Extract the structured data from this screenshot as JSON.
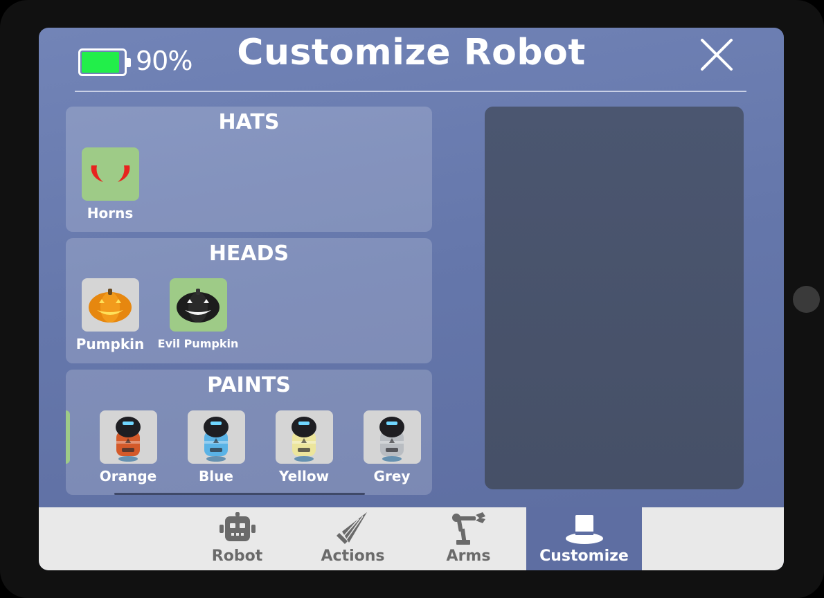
{
  "header": {
    "battery_percent": "90%",
    "battery_level": 0.9,
    "title": "Customize Robot"
  },
  "sections": {
    "hats": {
      "title": "HATS",
      "items": [
        {
          "label": "Horns",
          "icon": "horns-icon",
          "selected": true
        }
      ]
    },
    "heads": {
      "title": "HEADS",
      "items": [
        {
          "label": "Pumpkin",
          "icon": "pumpkin-icon",
          "selected": false
        },
        {
          "label": "Evil Pumpkin",
          "icon": "evil-pumpkin-icon",
          "selected": true
        }
      ]
    },
    "paints": {
      "title": "PAINTS",
      "items": [
        {
          "label": "Orange",
          "icon": "robot-orange-icon",
          "color": "#d45a2a"
        },
        {
          "label": "Blue",
          "icon": "robot-blue-icon",
          "color": "#5ab3e6"
        },
        {
          "label": "Yellow",
          "icon": "robot-yellow-icon",
          "color": "#ece59c"
        },
        {
          "label": "Grey",
          "icon": "robot-grey-icon",
          "color": "#b9bdc2"
        }
      ]
    }
  },
  "tabs": [
    {
      "label": "Robot",
      "icon": "robot-icon",
      "active": false
    },
    {
      "label": "Actions",
      "icon": "drill-icon",
      "active": false
    },
    {
      "label": "Arms",
      "icon": "robot-arm-icon",
      "active": false
    },
    {
      "label": "Customize",
      "icon": "top-hat-icon",
      "active": true
    }
  ],
  "colors": {
    "accent": "#5e6ea2",
    "selected_tile": "#9ecb87",
    "unselected_tile": "#d5d5d5",
    "battery": "#22ee4a"
  }
}
